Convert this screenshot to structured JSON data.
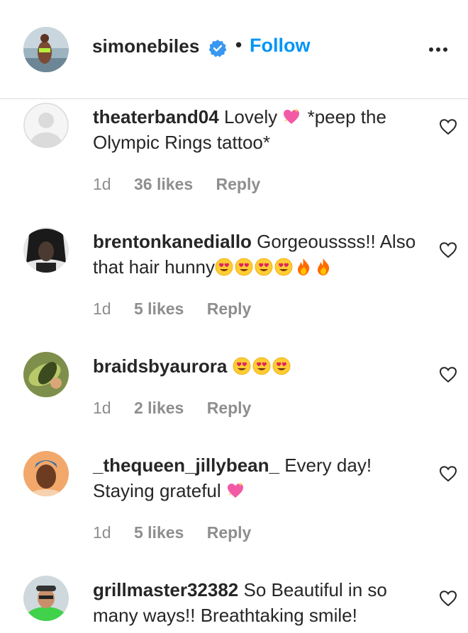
{
  "post": {
    "username": "simonebiles",
    "separator": "•",
    "follow_label": "Follow",
    "accent_color": "#0095f6",
    "verified_icon": "verified-badge-icon",
    "more_icon": "more-options-icon"
  },
  "comments": [
    {
      "username": "theaterband04",
      "text_before": "Lovely",
      "emoji_mid": "sparkling-heart-emoji",
      "text_after": "*peep the Olympic Rings tattoo*",
      "time": "1d",
      "likes": "36 likes",
      "reply": "Reply"
    },
    {
      "username": "brentonkanediallo",
      "text_before": "Gorgeoussss!! Also that hair hunny",
      "emojis": [
        "heart-eyes",
        "heart-eyes",
        "heart-eyes",
        "heart-eyes",
        "fire",
        "fire"
      ],
      "time": "1d",
      "likes": "5 likes",
      "reply": "Reply"
    },
    {
      "username": "braidsbyaurora",
      "emojis": [
        "heart-eyes",
        "heart-eyes",
        "heart-eyes"
      ],
      "time": "1d",
      "likes": "2 likes",
      "reply": "Reply"
    },
    {
      "username": "_thequeen_jillybean_",
      "text_before": "Every day! Staying grateful",
      "emojis": [
        "sparkling-heart"
      ],
      "time": "1d",
      "likes": "5 likes",
      "reply": "Reply"
    },
    {
      "username": "grillmaster32382",
      "text_before": "So Beautiful in so many ways!! Breathtaking smile!"
    }
  ]
}
